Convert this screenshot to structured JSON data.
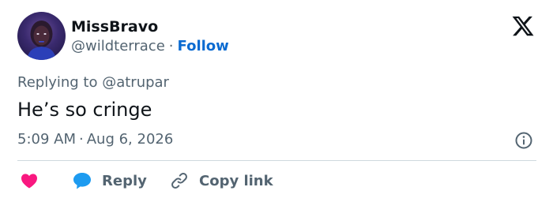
{
  "author": {
    "display_name": "MissBravo",
    "handle": "@wildterrace",
    "follow_label": "Follow"
  },
  "reply_context": "Replying to @atrupar",
  "tweet": {
    "text": "He’s so cringe",
    "time": "5:09 AM",
    "date": "Aug 6, 2026"
  },
  "actions": {
    "reply_label": "Reply",
    "copy_link_label": "Copy link"
  },
  "icons": {
    "logo": "x-logo-icon",
    "info": "info-icon",
    "like": "heart-icon",
    "reply": "speech-bubble-icon",
    "copy": "link-icon"
  },
  "colors": {
    "like": "#f91880",
    "reply": "#1d9bf0",
    "follow": "#0b6bd1",
    "secondary_text": "#536471"
  }
}
